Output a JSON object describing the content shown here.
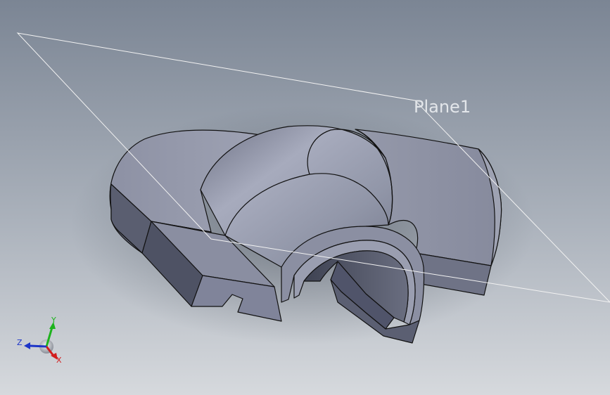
{
  "viewport": {
    "background_top": "#7b8594",
    "background_bottom": "#d6d9dd"
  },
  "plane": {
    "label": "Plane1",
    "edge_color": "#f2f2f2"
  },
  "model": {
    "face_color": "#8f93a6",
    "edge_color": "#111111"
  },
  "triad": {
    "x_label": "X",
    "y_label": "Y",
    "z_label": "Z",
    "x_color": "#d21d1d",
    "y_color": "#1db31d",
    "z_color": "#1d35c8"
  }
}
